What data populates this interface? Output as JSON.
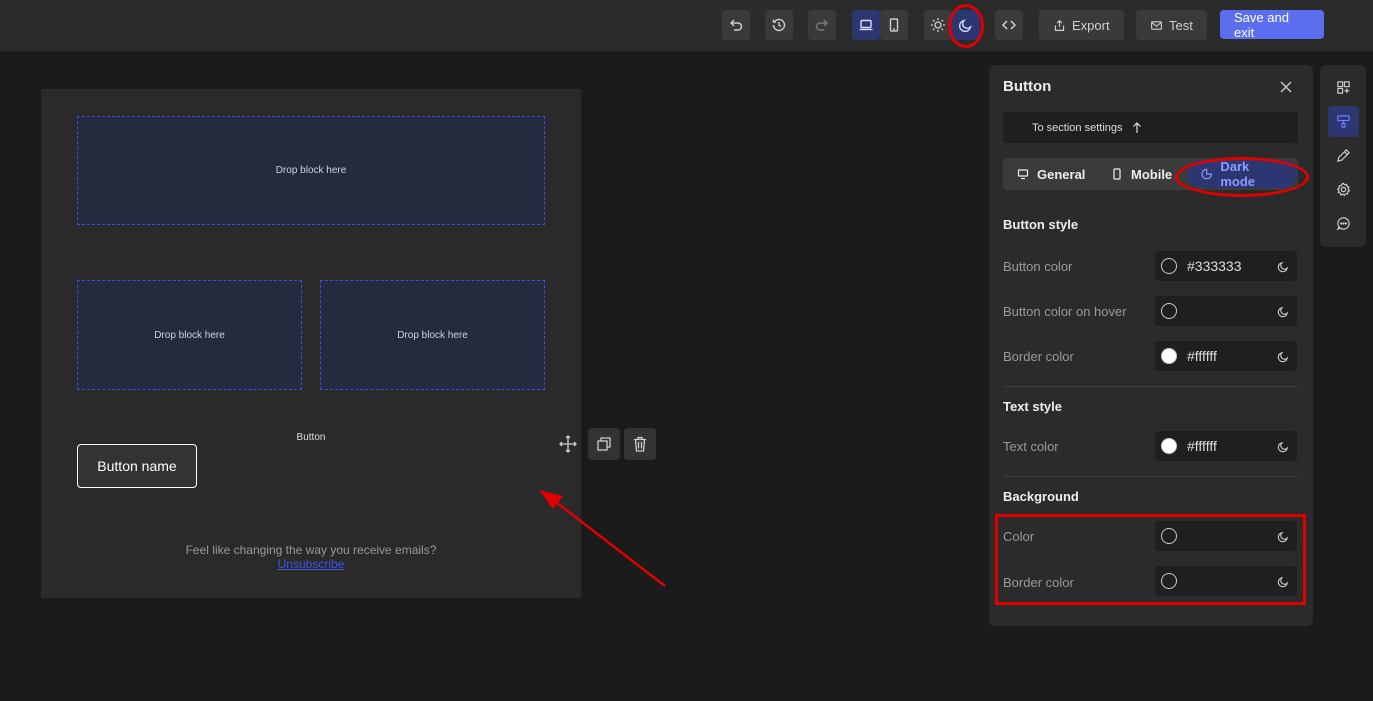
{
  "toolbar": {
    "export_label": "Export",
    "test_label": "Test",
    "save_exit_label": "Save and exit"
  },
  "email": {
    "drop_labels": [
      "Drop block here",
      "Drop block here",
      "Drop block here"
    ],
    "button_caption": "Button",
    "button_name": "Button name",
    "footer_text": "Feel like changing the way you receive emails?",
    "unsubscribe": "Unsubscribe"
  },
  "panel": {
    "title": "Button",
    "section_link": "To section settings",
    "tabs": [
      "General",
      "Mobile",
      "Dark mode"
    ],
    "active_tab": "Dark mode",
    "button_style": {
      "title": "Button style",
      "rows": [
        {
          "label": "Button color",
          "value": "#333333"
        },
        {
          "label": "Button color on hover",
          "value": ""
        },
        {
          "label": "Border color",
          "value": "#ffffff"
        }
      ]
    },
    "text_style": {
      "title": "Text style",
      "rows": [
        {
          "label": "Text color",
          "value": "#ffffff"
        }
      ]
    },
    "background": {
      "title": "Background",
      "rows": [
        {
          "label": "Color",
          "value": ""
        },
        {
          "label": "Border color",
          "value": ""
        }
      ]
    }
  },
  "colors": {
    "accent": "#5b6ef0",
    "highlight": "#e00000"
  }
}
